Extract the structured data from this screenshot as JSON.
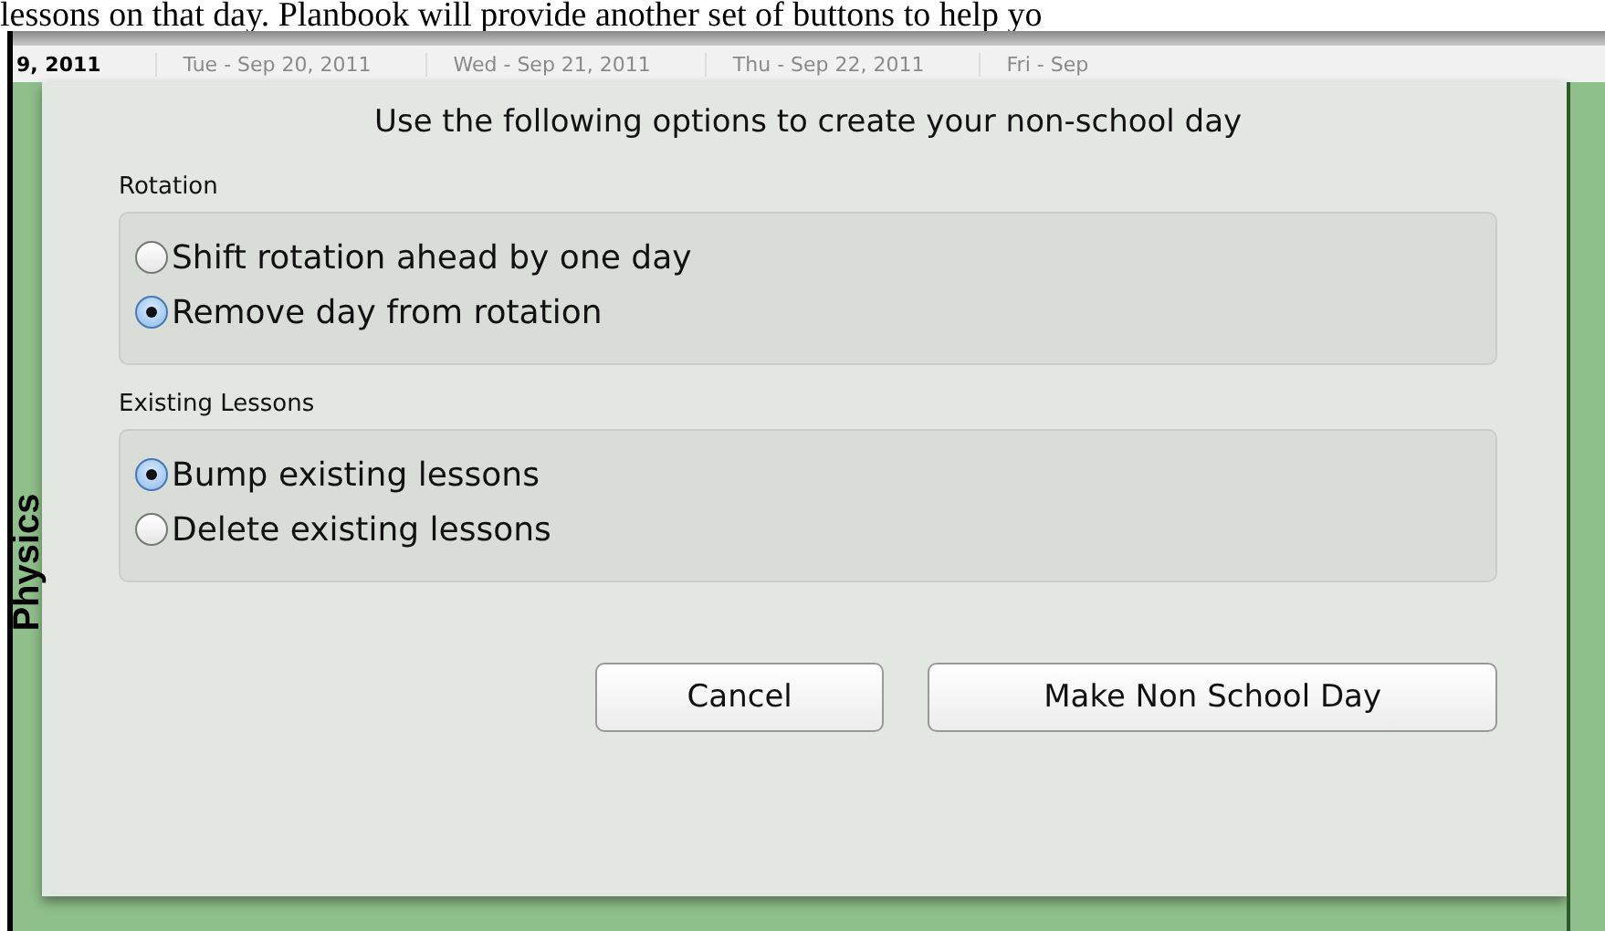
{
  "page_caption": "lessons on that day. Planbook will provide another set of buttons to help yo",
  "calendar": {
    "header": [
      {
        "label": "9, 2011",
        "faded": false
      },
      {
        "label": "Tue - Sep 20, 2011",
        "faded": true
      },
      {
        "label": "Wed - Sep 21, 2011",
        "faded": true
      },
      {
        "label": "Thu - Sep 22, 2011",
        "faded": true
      },
      {
        "label": "Fri - Sep",
        "faded": true
      }
    ],
    "side_label": "Physics"
  },
  "dialog": {
    "title": "Use the following options to create your non-school day",
    "groups": [
      {
        "label": "Rotation",
        "options": [
          {
            "label": "Shift rotation ahead by one day",
            "selected": false
          },
          {
            "label": "Remove day from rotation",
            "selected": true
          }
        ]
      },
      {
        "label": "Existing Lessons",
        "options": [
          {
            "label": "Bump existing lessons",
            "selected": true
          },
          {
            "label": "Delete existing lessons",
            "selected": false
          }
        ]
      }
    ],
    "buttons": [
      "Cancel",
      "Make Non School Day"
    ]
  }
}
